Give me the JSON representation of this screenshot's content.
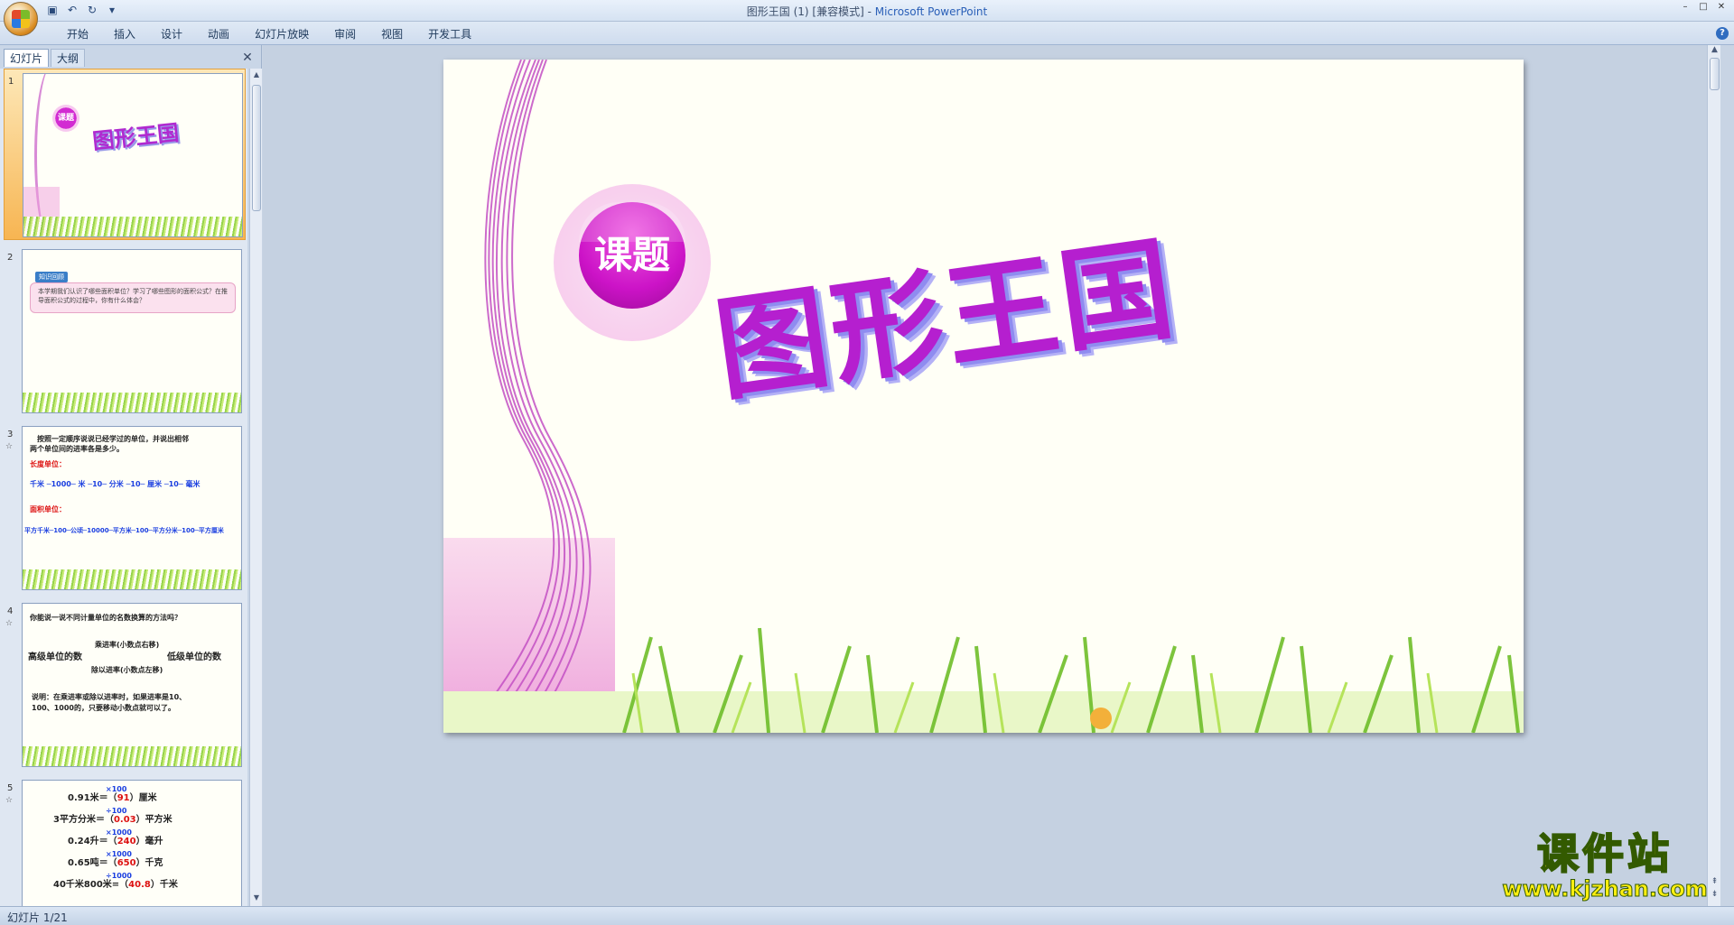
{
  "window": {
    "title_doc": "图形王国 (1) [兼容模式]",
    "title_sep": " - ",
    "title_app": "Microsoft PowerPoint",
    "controls": [
      "–",
      "□",
      "✕"
    ]
  },
  "qat": {
    "save_icon": "save-icon",
    "undo_icon": "undo-icon",
    "redo_icon": "redo-icon",
    "more_icon": "dropdown-icon"
  },
  "ribbon": {
    "tabs": [
      "开始",
      "插入",
      "设计",
      "动画",
      "幻灯片放映",
      "审阅",
      "视图",
      "开发工具"
    ],
    "help": "?"
  },
  "left_pane": {
    "tab_slides": "幻灯片",
    "tab_outline": "大纲",
    "close": "✕"
  },
  "thumbnails": {
    "s1": {
      "num": "1",
      "badge": "课题",
      "title": "图形王国"
    },
    "s2": {
      "num": "2",
      "anim": "☆",
      "tag": "知识回顾",
      "text": "本学期我们认识了哪些面积单位？学习了哪些图形的面积公式？在推导面积公式的过程中，你有什么体会？"
    },
    "s3": {
      "num": "3",
      "anim": "☆",
      "line1": "按照一定顺序说说已经学过的单位，并说出相邻",
      "line2": "两个单位间的进率各是多少。",
      "len_label": "长度单位：",
      "len_row": "千米 ─1000─ 米 ─10─ 分米 ─10─ 厘米 ─10─ 毫米",
      "area_label": "面积单位：",
      "area_row": "平方千米─100─公顷─10000─平方米─100─平方分米─100─平方厘米"
    },
    "s4": {
      "num": "4",
      "anim": "☆",
      "q": "你能说一说不同计量单位的名数换算的方法吗？",
      "mul": "乘进率(小数点右移)",
      "high": "高级单位的数",
      "low": "低级单位的数",
      "div": "除以进率(小数点左移)",
      "note1": "说明：在乘进率或除以进率时，如果进率是10、",
      "note2": "100、1000的，只要移动小数点就可以了。"
    },
    "s5": {
      "num": "5",
      "anim": "☆",
      "rows": [
        {
          "op": "×100",
          "left": "0.91米＝（",
          "ans": "91",
          "right": "）厘米"
        },
        {
          "op": "÷100",
          "left": "3平方分米＝（",
          "ans": "0.03",
          "right": "）平方米"
        },
        {
          "op": "×1000",
          "left": "0.24升＝（",
          "ans": "240",
          "right": "）毫升"
        },
        {
          "op": "×1000",
          "left": "0.65吨＝（",
          "ans": "650",
          "right": "）千克"
        },
        {
          "op": "÷1000",
          "left": "40千米800米=（",
          "ans": "40.8",
          "right": "）千米"
        }
      ]
    }
  },
  "slide": {
    "badge": "课题",
    "title": "图形王国"
  },
  "watermark": {
    "name": "课件站",
    "url": "www.kjzhan.com"
  },
  "status": {
    "slide_info": "幻灯片 1/21"
  }
}
